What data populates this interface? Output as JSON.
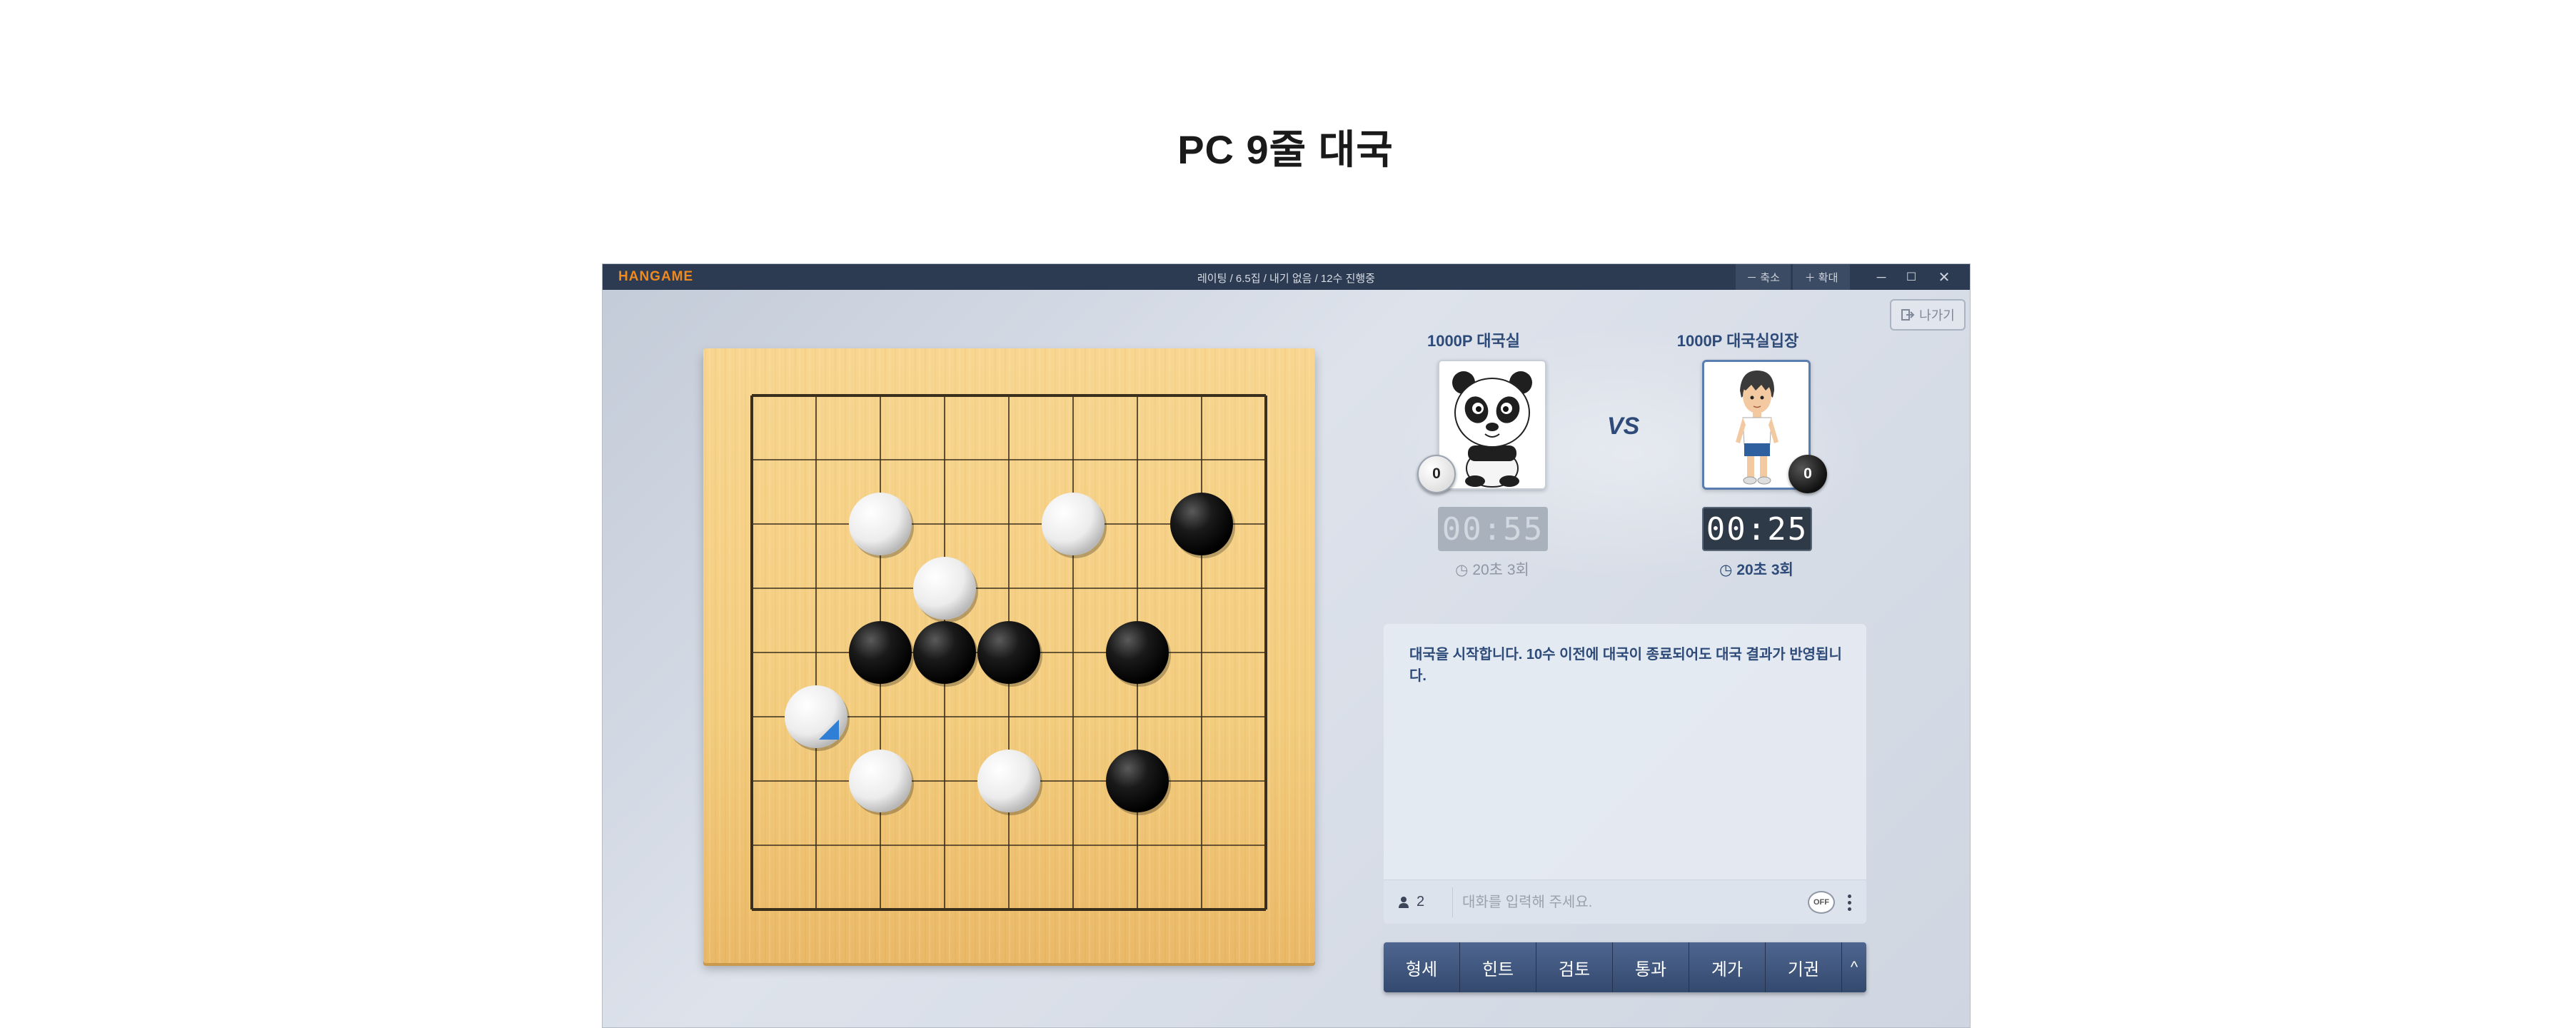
{
  "page": {
    "heading": "PC 9줄 대국"
  },
  "window": {
    "brand": "HANGAME",
    "title_info": "레이팅 / 6.5집 / 내기 없음 / 12수 진행중",
    "shrink_label": "－ 축소",
    "expand_label": "＋ 확대",
    "minimize_icon": "─",
    "maximize_icon": "☐",
    "close_icon": "✕",
    "exit_label": "나가기"
  },
  "players": {
    "player1": {
      "name": "1000P 대국실",
      "stone": "white",
      "captures": "0",
      "timer": "00:55",
      "time_rule": "20초 3회",
      "active": false
    },
    "player2": {
      "name": "1000P 대국실입장",
      "stone": "black",
      "captures": "0",
      "timer": "00:25",
      "time_rule": "20초 3회",
      "active": true
    },
    "vs_label": "VS"
  },
  "board": {
    "size": 9,
    "stones": [
      {
        "col": 2,
        "row": 2,
        "color": "white"
      },
      {
        "col": 5,
        "row": 2,
        "color": "white"
      },
      {
        "col": 7,
        "row": 2,
        "color": "black"
      },
      {
        "col": 3,
        "row": 3,
        "color": "white"
      },
      {
        "col": 2,
        "row": 4,
        "color": "black"
      },
      {
        "col": 3,
        "row": 4,
        "color": "black"
      },
      {
        "col": 4,
        "row": 4,
        "color": "black"
      },
      {
        "col": 6,
        "row": 4,
        "color": "black"
      },
      {
        "col": 1,
        "row": 5,
        "color": "white",
        "last_move": true
      },
      {
        "col": 2,
        "row": 6,
        "color": "white"
      },
      {
        "col": 4,
        "row": 6,
        "color": "white"
      },
      {
        "col": 6,
        "row": 6,
        "color": "black"
      }
    ]
  },
  "chat": {
    "message": "대국을 시작합니다. 10수 이전에 대국이 종료되어도 대국 결과가 반영됩니다.",
    "user_count": "2",
    "input_placeholder": "대화를 입력해 주세요.",
    "toggle_label": "OFF"
  },
  "actions": {
    "buttons": [
      "형세",
      "힌트",
      "검토",
      "통과",
      "계가",
      "기권"
    ],
    "more_icon": "^"
  }
}
